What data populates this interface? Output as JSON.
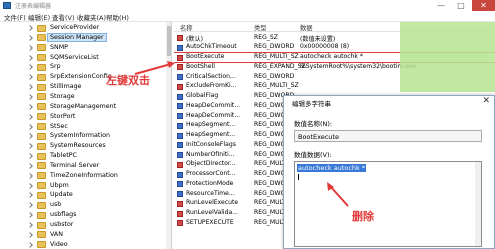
{
  "window": {
    "title": "注册表编辑器",
    "min": "—",
    "max": "□",
    "close": "✕"
  },
  "menu": [
    "文件(F)",
    "编辑(E)",
    "查看(V)",
    "收藏夹(A)",
    "帮助(H)"
  ],
  "tree": {
    "items": [
      {
        "label": "ServiceProvider"
      },
      {
        "label": "Session Manager",
        "selected": true
      },
      {
        "label": "SNMP"
      },
      {
        "label": "SQMServiceList"
      },
      {
        "label": "Srp"
      },
      {
        "label": "SrpExtensionConfig"
      },
      {
        "label": "StillImage"
      },
      {
        "label": "Storage"
      },
      {
        "label": "StorageManagement"
      },
      {
        "label": "StorPort"
      },
      {
        "label": "StSec"
      },
      {
        "label": "SystemInformation"
      },
      {
        "label": "SystemResources"
      },
      {
        "label": "TabletPC"
      },
      {
        "label": "Terminal Server"
      },
      {
        "label": "TimeZoneInformation"
      },
      {
        "label": "Ubpm"
      },
      {
        "label": "Update"
      },
      {
        "label": "usb"
      },
      {
        "label": "usbflags"
      },
      {
        "label": "usbstor"
      },
      {
        "label": "VAN"
      },
      {
        "label": "Video"
      }
    ]
  },
  "list": {
    "headers": {
      "name": "名称",
      "type": "类型",
      "data": "数据"
    },
    "rows": [
      {
        "name": "(默认)",
        "type": "REG_SZ",
        "data": "(数值未设置)",
        "icon": "str"
      },
      {
        "name": "AutoChkTimeout",
        "type": "REG_DWORD",
        "data": "0x00000008 (8)",
        "icon": "dw"
      },
      {
        "name": "BootExecute",
        "type": "REG_MULTI_SZ",
        "data": "autocheck autochk *",
        "icon": "str",
        "highlight": true
      },
      {
        "name": "BootShell",
        "type": "REG_EXPAND_SZ",
        "data": "%SystemRoot%\\system32\\bootim.exe",
        "icon": "str"
      },
      {
        "name": "CriticalSection...",
        "type": "REG_DWORD",
        "data": "",
        "icon": "dw"
      },
      {
        "name": "ExcludeFromKi...",
        "type": "REG_MULTI_SZ",
        "data": "",
        "icon": "str"
      },
      {
        "name": "GlobalFlag",
        "type": "REG_DWORD",
        "data": "",
        "icon": "dw"
      },
      {
        "name": "HeapDeCommit...",
        "type": "REG_DWORD",
        "data": "",
        "icon": "dw"
      },
      {
        "name": "HeapDeCommit...",
        "type": "REG_DWORD",
        "data": "",
        "icon": "dw"
      },
      {
        "name": "HeapSegment...",
        "type": "REG_DWORD",
        "data": "",
        "icon": "dw"
      },
      {
        "name": "HeapSegment...",
        "type": "REG_DWORD",
        "data": "",
        "icon": "dw"
      },
      {
        "name": "InitConsoleFlags",
        "type": "REG_DWORD",
        "data": "",
        "icon": "dw"
      },
      {
        "name": "NumberOfIniti...",
        "type": "REG_DWORD",
        "data": "",
        "icon": "dw"
      },
      {
        "name": "ObjectDirector...",
        "type": "REG_MULTI_SZ",
        "data": "",
        "icon": "str"
      },
      {
        "name": "ProcessorCont...",
        "type": "REG_DWORD",
        "data": "",
        "icon": "dw"
      },
      {
        "name": "ProtectionMode",
        "type": "REG_DWORD",
        "data": "",
        "icon": "dw"
      },
      {
        "name": "ResourceTime...",
        "type": "REG_DWORD",
        "data": "",
        "icon": "dw"
      },
      {
        "name": "RunLevelExecute",
        "type": "REG_MULTI_SZ",
        "data": "",
        "icon": "str"
      },
      {
        "name": "RunLevelValida...",
        "type": "REG_MULTI_SZ",
        "data": "",
        "icon": "str"
      },
      {
        "name": "SETUPEXECUTE",
        "type": "REG_MULTI_SZ",
        "data": "",
        "icon": "str"
      }
    ]
  },
  "annotations": {
    "left_double_click": "左键双击",
    "delete": "删除"
  },
  "dialog": {
    "title": "编辑多字符串",
    "close": "✕",
    "name_label": "数值名称(N):",
    "name_value": "BootExecute",
    "data_label": "数值数据(V):",
    "data_value": "autocheck autochk *"
  },
  "colors": {
    "annotation": "#e23a3a",
    "selection": "#3878d8",
    "mask": "#b5e48f"
  }
}
